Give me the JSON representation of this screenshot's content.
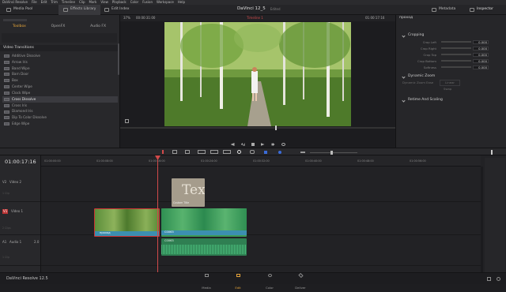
{
  "menubar": {
    "items": [
      "DaVinci Resolve",
      "File",
      "Edit",
      "Trim",
      "Timeline",
      "Clip",
      "Mark",
      "View",
      "Playback",
      "Color",
      "Fusion",
      "Workspace",
      "Help"
    ]
  },
  "topbar": {
    "media_pool": "Media Pool",
    "effects_library": "Effects Library",
    "edit_index": "Edit Index",
    "project_title": "DaVinci 12_5",
    "project_status": "Edited",
    "metadata": "Metadata",
    "inspector": "Inspector"
  },
  "effects": {
    "tabs": [
      "Toolbox",
      "OpenFX",
      "Audio FX"
    ],
    "active_tab": "Toolbox",
    "section_title": "Video Transitions",
    "items": [
      "Additive Dissolve",
      "Arrow Iris",
      "Band Wipe",
      "Barn Door",
      "Box",
      "Center Wipe",
      "Clock Wipe",
      "Cross Dissolve",
      "Cross Iris",
      "Diamond Iris",
      "Dip To Color Dissolve",
      "Edge Wipe"
    ],
    "selected": "Cross Dissolve"
  },
  "viewer": {
    "zoom": "37%",
    "timecode_left": "00:00:31:00",
    "timeline_name": "Timeline 1",
    "timecode_right": "01:00:17:16",
    "clip_name": "проход"
  },
  "inspector": {
    "cropping": {
      "title": "Cropping",
      "rows": [
        {
          "label": "Crop Left",
          "value": "0.000"
        },
        {
          "label": "Crop Right",
          "value": "0.000"
        },
        {
          "label": "Crop Top",
          "value": "0.000"
        },
        {
          "label": "Crop Bottom",
          "value": "0.000"
        },
        {
          "label": "Softness",
          "value": "0.000"
        }
      ]
    },
    "dynamic_zoom": {
      "title": "Dynamic Zoom",
      "ease_label": "Dynamic Zoom Ease",
      "ease_value": "Linear",
      "swap": "Swap"
    },
    "retime": {
      "title": "Retime And Scaling"
    }
  },
  "timeline": {
    "current_timecode": "01:00:17:16",
    "ruler": [
      "01:00:00:00",
      "01:00:08:00",
      "01:00:16:00",
      "01:00:24:00",
      "01:00:32:00",
      "01:00:40:00",
      "01:00:48:00",
      "01:00:56:00"
    ],
    "tracks": [
      {
        "id": "V2",
        "name": "Video 2",
        "clips": "1 Clip"
      },
      {
        "id": "V1",
        "name": "Video 1",
        "clips": "2 Clips"
      },
      {
        "id": "A1",
        "name": "Audio 1",
        "channel": "2.0",
        "clips": "1 Clip"
      }
    ],
    "text_clip": "Text",
    "text_clip_label": "Custom Title",
    "clip1_name": "проход",
    "clip2_name": "C0063",
    "audio_clip_name": "C0063"
  },
  "bottombar": {
    "app_name": "DaVinci Resolve 12.5",
    "pages": [
      "Media",
      "Edit",
      "Color",
      "Deliver"
    ],
    "active_page": "Edit"
  },
  "colors": {
    "accent": "#e6a53a",
    "video_clip": "#3c8fb0",
    "audio_clip": "#3a9a64",
    "selected_clip_border": "#c33"
  }
}
